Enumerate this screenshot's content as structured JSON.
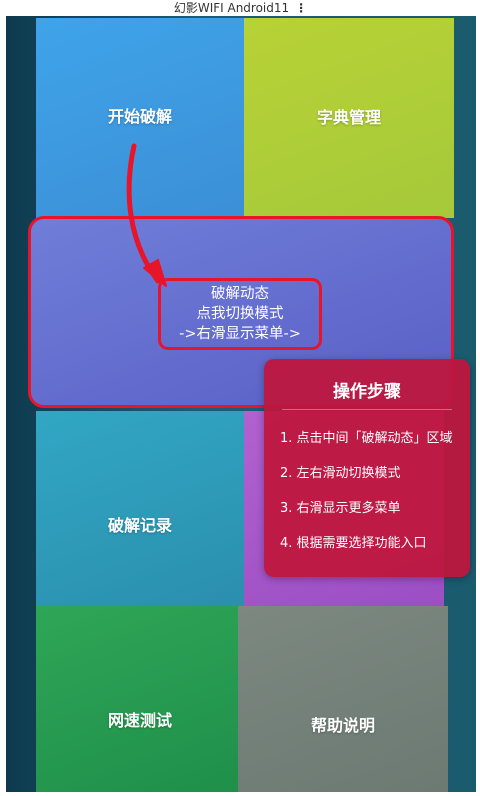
{
  "window": {
    "title": "幻影WIFI Android11",
    "menu_icon": "kebab-menu-icon"
  },
  "tiles": {
    "start": "开始破解",
    "dictionary": "字典管理",
    "records": "破解记录",
    "speed_test": "网速测试",
    "help": "帮助说明"
  },
  "status": {
    "line1": "破解动态",
    "line2": "点我切换模式",
    "line3": "->右滑显示菜单->"
  },
  "steps": {
    "title": "操作步骤",
    "items": [
      "1. 点击中间「破解动态」区域",
      "2. 左右滑动切换模式",
      "3. 右滑显示更多菜单",
      "4. 根据需要选择功能入口"
    ]
  },
  "colors": {
    "annotation_red": "#e8152a",
    "tile_start": "#3c97e0",
    "tile_dictionary": "#abcc38",
    "tile_records": "#2e9bb9",
    "tile_speed": "#27994f",
    "tile_help": "#75817a",
    "status_panel": "#6470cf",
    "steps_panel": "#be163e"
  }
}
